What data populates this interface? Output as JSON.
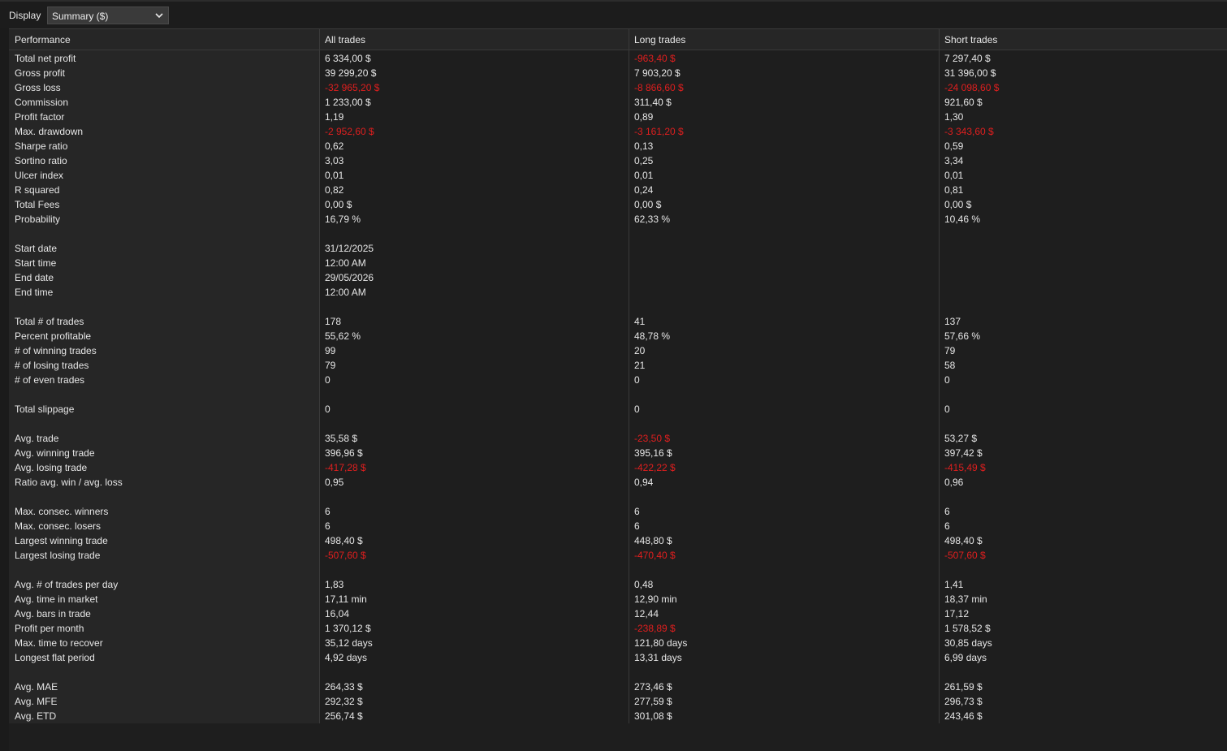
{
  "toolbar": {
    "display_label": "Display",
    "display_value": "Summary ($)",
    "chevron_icon": "chevron-down-icon"
  },
  "table": {
    "headers": [
      "Performance",
      "All trades",
      "Long trades",
      "Short trades"
    ],
    "negative_color": "#e01e1e",
    "rows": [
      {
        "label": "Total net profit",
        "all": "6 334,00 $",
        "long": "-963,40 $",
        "short": "7 297,40 $"
      },
      {
        "label": "Gross profit",
        "all": "39 299,20 $",
        "long": "7 903,20 $",
        "short": "31 396,00 $"
      },
      {
        "label": "Gross loss",
        "all": "-32 965,20 $",
        "long": "-8 866,60 $",
        "short": "-24 098,60 $"
      },
      {
        "label": "Commission",
        "all": "1 233,00 $",
        "long": "311,40 $",
        "short": "921,60 $"
      },
      {
        "label": "Profit factor",
        "all": "1,19",
        "long": "0,89",
        "short": "1,30"
      },
      {
        "label": "Max. drawdown",
        "all": "-2 952,60 $",
        "long": "-3 161,20 $",
        "short": "-3 343,60 $"
      },
      {
        "label": "Sharpe ratio",
        "all": "0,62",
        "long": "0,13",
        "short": "0,59"
      },
      {
        "label": "Sortino ratio",
        "all": "3,03",
        "long": "0,25",
        "short": "3,34"
      },
      {
        "label": "Ulcer index",
        "all": "0,01",
        "long": "0,01",
        "short": "0,01"
      },
      {
        "label": "R squared",
        "all": "0,82",
        "long": "0,24",
        "short": "0,81"
      },
      {
        "label": "Total Fees",
        "all": "0,00 $",
        "long": "0,00 $",
        "short": "0,00 $"
      },
      {
        "label": "Probability",
        "all": "16,79 %",
        "long": "62,33 %",
        "short": "10,46 %"
      },
      {
        "label": "",
        "all": "",
        "long": "",
        "short": ""
      },
      {
        "label": "Start date",
        "all": "31/12/2025",
        "long": "",
        "short": ""
      },
      {
        "label": "Start time",
        "all": "12:00 AM",
        "long": "",
        "short": ""
      },
      {
        "label": "End date",
        "all": "29/05/2026",
        "long": "",
        "short": ""
      },
      {
        "label": "End time",
        "all": "12:00 AM",
        "long": "",
        "short": ""
      },
      {
        "label": "",
        "all": "",
        "long": "",
        "short": ""
      },
      {
        "label": "Total # of trades",
        "all": "178",
        "long": "41",
        "short": "137"
      },
      {
        "label": "Percent profitable",
        "all": "55,62 %",
        "long": "48,78 %",
        "short": "57,66 %"
      },
      {
        "label": "# of winning trades",
        "all": "99",
        "long": "20",
        "short": "79"
      },
      {
        "label": "# of losing trades",
        "all": "79",
        "long": "21",
        "short": "58"
      },
      {
        "label": "# of even trades",
        "all": "0",
        "long": "0",
        "short": "0"
      },
      {
        "label": "",
        "all": "",
        "long": "",
        "short": ""
      },
      {
        "label": "Total slippage",
        "all": "0",
        "long": "0",
        "short": "0"
      },
      {
        "label": "",
        "all": "",
        "long": "",
        "short": ""
      },
      {
        "label": "Avg. trade",
        "all": "35,58 $",
        "long": "-23,50 $",
        "short": "53,27 $"
      },
      {
        "label": "Avg. winning trade",
        "all": "396,96 $",
        "long": "395,16 $",
        "short": "397,42 $"
      },
      {
        "label": "Avg. losing trade",
        "all": "-417,28 $",
        "long": "-422,22 $",
        "short": "-415,49 $"
      },
      {
        "label": "Ratio avg. win / avg. loss",
        "all": "0,95",
        "long": "0,94",
        "short": "0,96"
      },
      {
        "label": "",
        "all": "",
        "long": "",
        "short": ""
      },
      {
        "label": "Max. consec. winners",
        "all": "6",
        "long": "6",
        "short": "6"
      },
      {
        "label": "Max. consec. losers",
        "all": "6",
        "long": "6",
        "short": "6"
      },
      {
        "label": "Largest winning trade",
        "all": "498,40 $",
        "long": "448,80 $",
        "short": "498,40 $"
      },
      {
        "label": "Largest losing trade",
        "all": "-507,60 $",
        "long": "-470,40 $",
        "short": "-507,60 $"
      },
      {
        "label": "",
        "all": "",
        "long": "",
        "short": ""
      },
      {
        "label": "Avg. # of trades per day",
        "all": "1,83",
        "long": "0,48",
        "short": "1,41"
      },
      {
        "label": "Avg. time in market",
        "all": "17,11 min",
        "long": "12,90 min",
        "short": "18,37 min"
      },
      {
        "label": "Avg. bars in trade",
        "all": "16,04",
        "long": "12,44",
        "short": "17,12"
      },
      {
        "label": "Profit per month",
        "all": "1 370,12 $",
        "long": "-238,89 $",
        "short": "1 578,52 $"
      },
      {
        "label": "Max. time to recover",
        "all": "35,12 days",
        "long": "121,80 days",
        "short": "30,85 days"
      },
      {
        "label": "Longest flat period",
        "all": "4,92 days",
        "long": "13,31 days",
        "short": "6,99 days"
      },
      {
        "label": "",
        "all": "",
        "long": "",
        "short": ""
      },
      {
        "label": "Avg. MAE",
        "all": "264,33 $",
        "long": "273,46 $",
        "short": "261,59 $"
      },
      {
        "label": "Avg. MFE",
        "all": "292,32 $",
        "long": "277,59 $",
        "short": "296,73 $"
      },
      {
        "label": "Avg. ETD",
        "all": "256,74 $",
        "long": "301,08 $",
        "short": "243,46 $"
      }
    ]
  }
}
